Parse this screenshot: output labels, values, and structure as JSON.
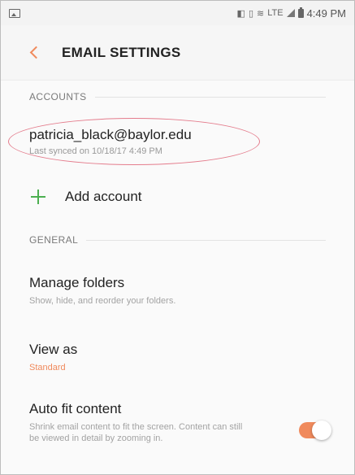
{
  "status_bar": {
    "time": "4:49 PM",
    "signal_label": "LTE"
  },
  "header": {
    "title": "EMAIL SETTINGS"
  },
  "accounts_section": {
    "header": "ACCOUNTS",
    "account": {
      "email": "patricia_black@baylor.edu",
      "last_synced": "Last synced on 10/18/17  4:49 PM"
    },
    "add_account_label": "Add account"
  },
  "general_section": {
    "header": "GENERAL",
    "manage_folders": {
      "title": "Manage folders",
      "subtitle": "Show, hide, and reorder your folders."
    },
    "view_as": {
      "title": "View as",
      "value": "Standard"
    },
    "auto_fit": {
      "title": "Auto fit content",
      "subtitle": "Shrink email content to fit the screen. Content can still be viewed in detail by zooming in.",
      "enabled": true
    }
  },
  "colors": {
    "accent": "#f08a5c",
    "add_icon": "#4caf50",
    "highlight_ellipse": "#e47c8c"
  }
}
